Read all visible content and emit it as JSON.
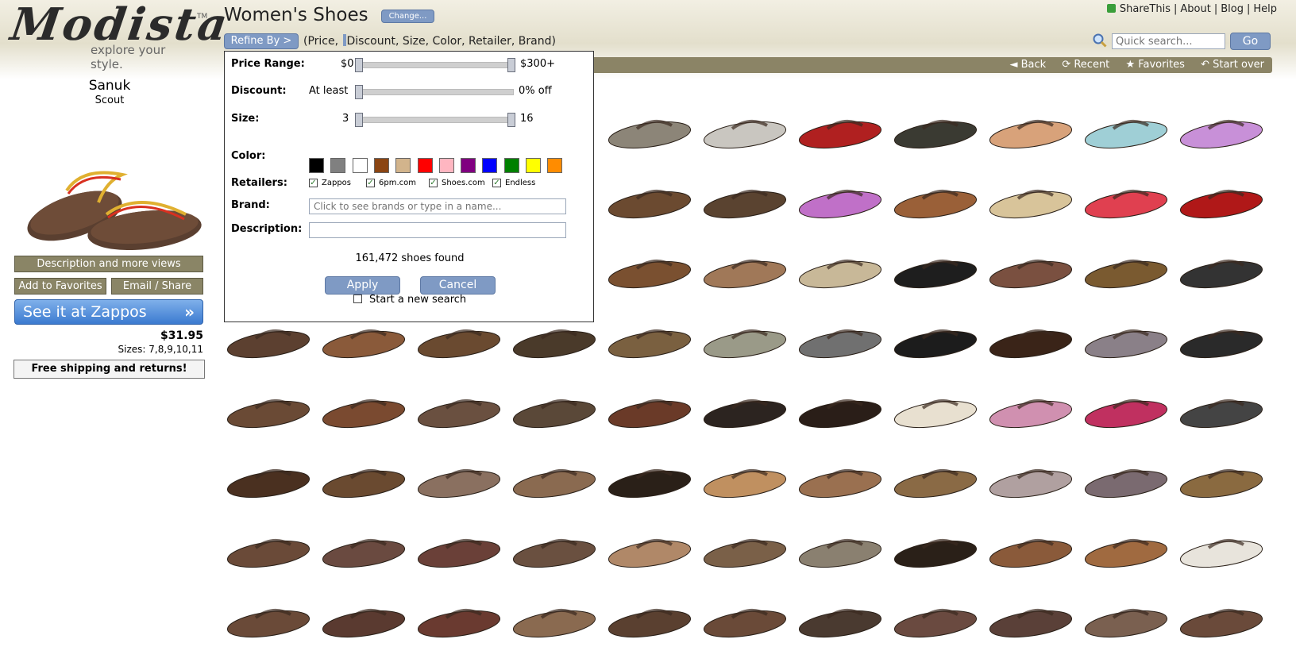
{
  "logo": {
    "main": "Modista",
    "tm": "TM",
    "tagline": "explore your style."
  },
  "header": {
    "title": "Women's Shoes",
    "change_label": "Change...",
    "refine_label": "Refine By >",
    "refine_hint_pre": "(Price, ",
    "refine_hint_post": "Discount, Size, Color, Retailer, Brand)"
  },
  "toplinks": {
    "sharethis": "ShareThis",
    "about": "About",
    "blog": "Blog",
    "help": "Help",
    "sep": "|"
  },
  "search": {
    "placeholder": "Quick search...",
    "go_label": "Go"
  },
  "nav": {
    "back": "◄ Back",
    "recent": "⟳ Recent",
    "favorites": "★ Favorites",
    "startover": "↶ Start over"
  },
  "product": {
    "brand": "Sanuk",
    "model": "Scout",
    "desc_button": "Description and more views",
    "fav_button": "Add to Favorites",
    "email_button": "Email / Share",
    "zappos_button": "See it at Zappos",
    "zappos_arrow": "»",
    "price": "$31.95",
    "sizes": "Sizes: 7,8,9,10,11",
    "shipping": "Free shipping and returns!"
  },
  "refine": {
    "price_label": "Price Range:",
    "price_min": "$0",
    "price_max": "$300+",
    "discount_label": "Discount:",
    "discount_prefix": "At least",
    "discount_value": "0% off",
    "size_label": "Size:",
    "size_min": "3",
    "size_max": "16",
    "color_label": "Color:",
    "colors": [
      "#000000",
      "#808080",
      "#ffffff",
      "#8b4513",
      "#d2b48c",
      "#ff0000",
      "#ffb6c1",
      "#800080",
      "#0000ff",
      "#008000",
      "#ffff00",
      "#ff8c00"
    ],
    "retailers_label": "Retailers:",
    "retailers": [
      "Zappos",
      "6pm.com",
      "Shoes.com",
      "Endless"
    ],
    "retailers_checked": [
      true,
      true,
      true,
      true
    ],
    "brand_label": "Brand:",
    "brand_placeholder": "Click to see brands or type in a name...",
    "description_label": "Description:",
    "description_value": "",
    "found_text": "161,472 shoes found",
    "apply_label": "Apply",
    "cancel_label": "Cancel",
    "new_search_label": "Start a new search",
    "new_search_checked": false
  },
  "grid": {
    "rows": [
      [
        "#8c8578",
        "#c9c6c0",
        "#b02020",
        "#3a3a32",
        "#d8a27a",
        "#9fcfd6",
        "#c890d8"
      ],
      [
        "#6b4a30",
        "#5a4330",
        "#c070c8",
        "#9a6038",
        "#d8c49a",
        "#e04050",
        "#b01818"
      ],
      [
        "#7a5030",
        "#a07858",
        "#c8b898",
        "#1e1e1e",
        "#7a5040",
        "#7a5a30",
        "#333333"
      ],
      [
        "#5c4030",
        "#8a5a3a",
        "#6a4a30",
        "#4a3a2a",
        "#7a6040",
        "#9a9a88",
        "#707070",
        "#1c1c1c",
        "#3a2418",
        "#8a8088",
        "#2a2a2a"
      ],
      [
        "#6a4a35",
        "#7a4a30",
        "#6a5040",
        "#5a4838",
        "#6a3a28",
        "#2c2420",
        "#2a1e18",
        "#e8e0d0",
        "#d090b0",
        "#c03060",
        "#444444"
      ],
      [
        "#4a3020",
        "#6a4a30",
        "#8a7060",
        "#8a6a50",
        "#2a2018",
        "#c09060",
        "#9a7050",
        "#8a6a45",
        "#b0a0a0",
        "#7a6a70",
        "#8a6a40"
      ],
      [
        "#6a4a38",
        "#6a4a40",
        "#6a4038",
        "#6a5040",
        "#b08868",
        "#7a6048",
        "#8a8070",
        "#2a2018",
        "#8a5a3a",
        "#a06a40",
        "#e8e4dc"
      ],
      [
        "#6a4a38",
        "#5a3a30",
        "#6a3a30",
        "#8a6a50",
        "#5a4030",
        "#6a4a38",
        "#4a3a30",
        "#6a4a40",
        "#5a4038",
        "#7a6050",
        "#6a4a3a"
      ]
    ],
    "row1_start_col": 4
  }
}
